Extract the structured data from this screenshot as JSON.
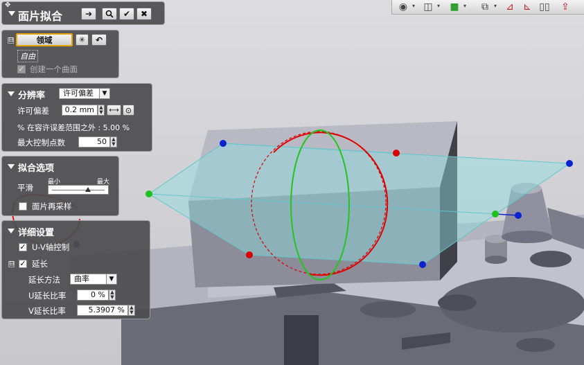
{
  "title": "面片拟合",
  "title_buttons": {
    "next": "➔",
    "preview": "🔍",
    "ok": "✔",
    "cancel": "✖"
  },
  "region": {
    "collapse": "⊟",
    "region_button": "领域",
    "free_label": "自由",
    "create_one_surface": "创建一个曲面",
    "create_one_surface_checked": true
  },
  "resolution": {
    "header": "分辨率",
    "mode": "许可偏差",
    "tolerance_label": "许可偏差",
    "tolerance_value": "0.2 mm",
    "outside_text": "% 在容许误差范围之外 : 5.00 %",
    "max_control_points_label": "最大控制点数",
    "max_control_points_value": "50"
  },
  "fit_options": {
    "header": "拟合选项",
    "smooth_label": "平滑",
    "slider_min": "最小",
    "slider_max": "最大",
    "smooth_level": 0.7,
    "resample_label": "面片再采样",
    "resample_checked": false
  },
  "details": {
    "header": "详细设置",
    "uv_control_label": "U-V轴控制",
    "uv_control_checked": true,
    "extend_label": "延长",
    "extend_checked": true,
    "extend_method_label": "延长方法",
    "extend_method_value": "曲率",
    "u_ratio_label": "U延长比率",
    "u_ratio_value": "0 %",
    "v_ratio_label": "V延长比率",
    "v_ratio_value": "5.3907 %"
  },
  "colors": {
    "panel_bg": "#4e4e50",
    "highlight": "#e8a400",
    "annotation": "#e0140c",
    "point_blue": "#0a23d0",
    "point_red": "#d80000",
    "point_green": "#20c020",
    "surface_cyan": "#8fdde0"
  },
  "viewport_icons": [
    "view-style-icon",
    "box-icon",
    "color-map-icon",
    "section-icon",
    "flip-icon",
    "mirror-icon",
    "split-icon",
    "export-icon"
  ]
}
